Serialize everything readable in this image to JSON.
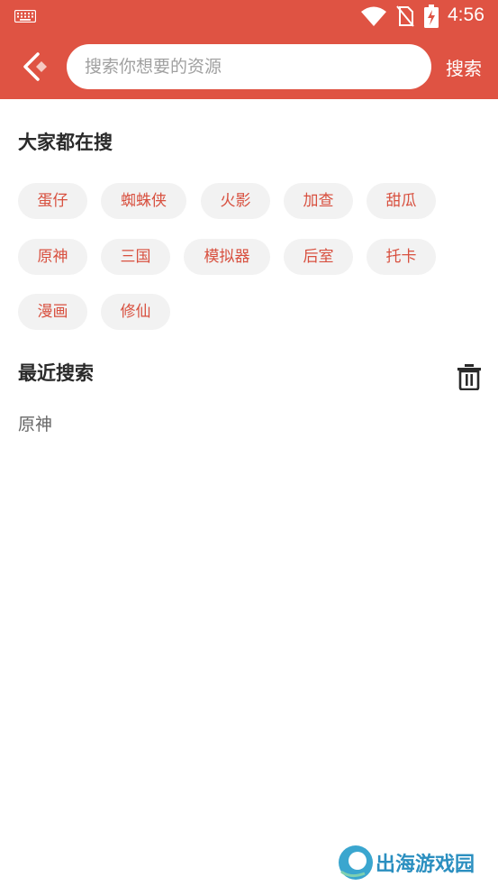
{
  "status_bar": {
    "time": "4:56",
    "icons": [
      "keyboard-icon",
      "wifi-icon",
      "no-sim-icon",
      "battery-charging-icon"
    ]
  },
  "header": {
    "back_icon": "chevron-left-icon",
    "search_placeholder": "搜索你想要的资源",
    "search_value": "",
    "search_button": "搜索"
  },
  "hot": {
    "title": "大家都在搜",
    "tags": [
      "蛋仔",
      "蜘蛛侠",
      "火影",
      "加查",
      "甜瓜",
      "原神",
      "三国",
      "模拟器",
      "后室",
      "托卡",
      "漫画",
      "修仙"
    ]
  },
  "recent": {
    "title": "最近搜索",
    "clear_icon": "trash-icon",
    "items": [
      "原神"
    ]
  },
  "watermark": {
    "text": "出海游戏园"
  },
  "colors": {
    "brand": "#df5343",
    "tag_text": "#d8503f",
    "tag_bg": "#f2f2f2"
  }
}
